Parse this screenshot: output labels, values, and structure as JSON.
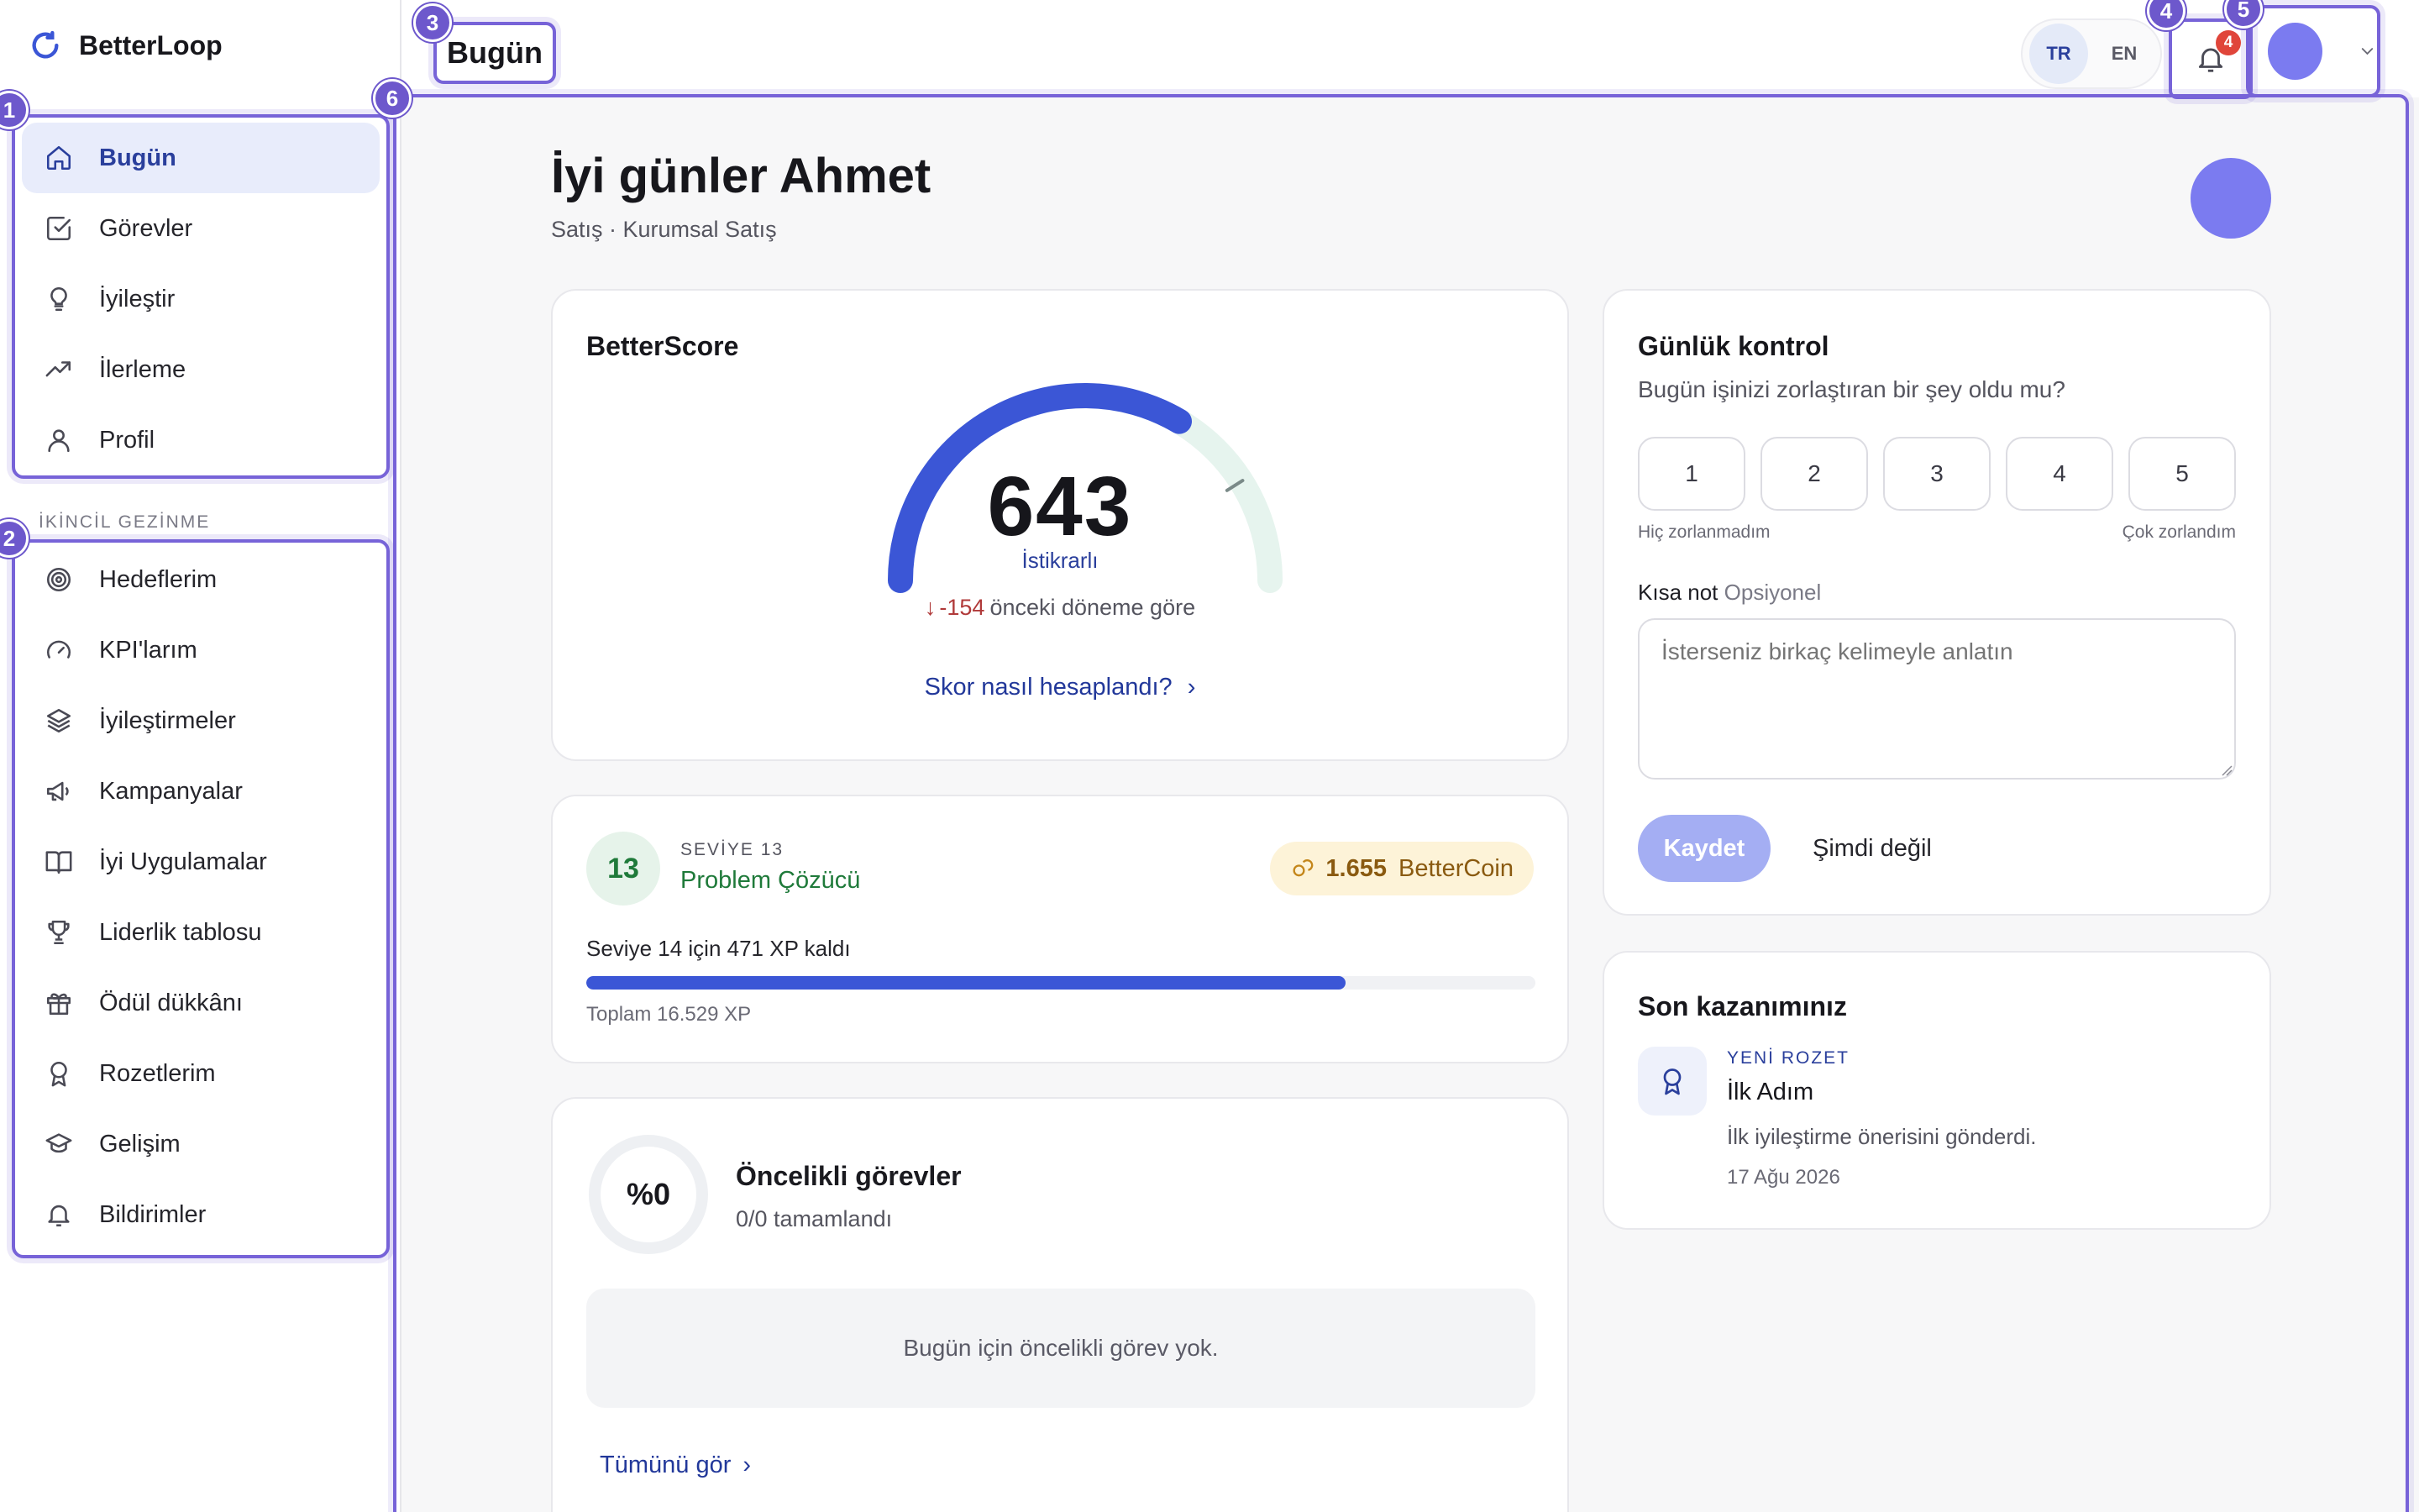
{
  "app": {
    "name": "BetterLoop"
  },
  "sidebar": {
    "primary": [
      {
        "label": "Bugün",
        "icon": "home-icon",
        "active": true
      },
      {
        "label": "Görevler",
        "icon": "checkbox-icon"
      },
      {
        "label": "İyileştir",
        "icon": "lightbulb-icon"
      },
      {
        "label": "İlerleme",
        "icon": "trending-up-icon"
      },
      {
        "label": "Profil",
        "icon": "user-icon"
      }
    ],
    "secondary_label": "İKİNCİL GEZİNME",
    "secondary": [
      {
        "label": "Hedeflerim",
        "icon": "target-icon"
      },
      {
        "label": "KPI'larım",
        "icon": "gauge-icon"
      },
      {
        "label": "İyileştirmeler",
        "icon": "layers-icon"
      },
      {
        "label": "Kampanyalar",
        "icon": "megaphone-icon"
      },
      {
        "label": "İyi Uygulamalar",
        "icon": "book-icon"
      },
      {
        "label": "Liderlik tablosu",
        "icon": "trophy-icon"
      },
      {
        "label": "Ödül dükkânı",
        "icon": "gift-icon"
      },
      {
        "label": "Rozetlerim",
        "icon": "award-icon"
      },
      {
        "label": "Gelişim",
        "icon": "graduation-cap-icon"
      },
      {
        "label": "Bildirimler",
        "icon": "bell-icon"
      }
    ]
  },
  "annotations": [
    "1",
    "2",
    "3",
    "4",
    "5",
    "6"
  ],
  "topbar": {
    "page_title": "Bugün",
    "languages": [
      {
        "code": "TR",
        "active": true
      },
      {
        "code": "EN",
        "active": false
      }
    ],
    "notification_count": "4"
  },
  "header": {
    "greeting": "İyi günler Ahmet",
    "subtitle": "Satış · Kurumsal Satış"
  },
  "score": {
    "title": "BetterScore",
    "value": "643",
    "state": "İstikrarlı",
    "delta": "-154",
    "delta_suffix": "önceki döneme göre",
    "link": "Skor nasıl hesaplandı?",
    "gauge_fraction": 0.67,
    "target_fraction": 0.82,
    "colors": {
      "arc": "#3b56d6",
      "track": "#e6f4ee",
      "marker": "#7a8a88"
    }
  },
  "level": {
    "number": "13",
    "kicker": "SEVİYE 13",
    "name": "Problem Çözücü",
    "coins": "1.655",
    "coin_unit": "BetterCoin",
    "remaining": "Seviye 14 için 471 XP kaldı",
    "progress_fraction": 0.8,
    "total": "Toplam 16.529 XP"
  },
  "tasks": {
    "percent_label": "%0",
    "progress_fraction": 0,
    "title": "Öncelikli görevler",
    "subtitle": "0/0 tamamlandı",
    "empty": "Bugün için öncelikli görev yok.",
    "see_all": "Tümünü gör"
  },
  "daily_check": {
    "title": "Günlük kontrol",
    "question": "Bugün işinizi zorlaştıran bir şey oldu mu?",
    "options": [
      "1",
      "2",
      "3",
      "4",
      "5"
    ],
    "min_label": "Hiç zorlanmadım",
    "max_label": "Çok zorlandım",
    "note_label": "Kısa not",
    "note_optional": "Opsiyonel",
    "note_placeholder": "İsterseniz birkaç kelimeyle anlatın",
    "save": "Kaydet",
    "later": "Şimdi değil"
  },
  "achievement": {
    "title": "Son kazanımınız",
    "kicker": "YENİ ROZET",
    "name": "İlk Adım",
    "description": "İlk iyileştirme önerisini gönderdi.",
    "date": "17 Ağu 2026"
  }
}
